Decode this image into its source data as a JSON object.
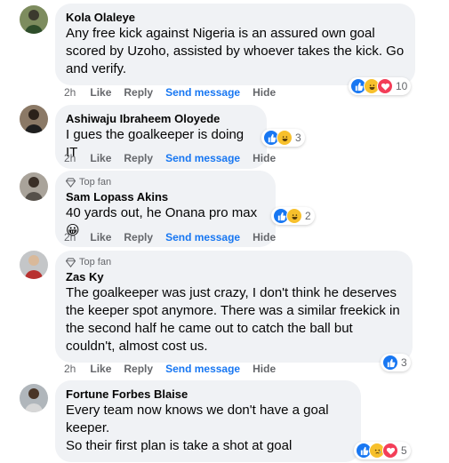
{
  "actions": {
    "like": "Like",
    "reply": "Reply",
    "send": "Send message",
    "hide": "Hide"
  },
  "comments": [
    {
      "author": "Kola Olaleye",
      "top_fan": false,
      "lines": [
        "Any free kick against Nigeria is an assured own goal",
        "scored by Uzoho, assisted by whoever takes the kick. Go",
        "and verify."
      ],
      "time": "2h",
      "reactions": [
        "like",
        "haha",
        "love"
      ],
      "count": "10"
    },
    {
      "author": "Ashiwaju Ibraheem Oloyede",
      "top_fan": false,
      "lines": [
        "I gues the goalkeeper is doing IT"
      ],
      "time": "2h",
      "reactions": [
        "like",
        "haha"
      ],
      "count": "3"
    },
    {
      "author": "Sam Lopass Akins",
      "top_fan": true,
      "lines": [
        "40 yards out, he Onana pro max😀"
      ],
      "time": "2h",
      "reactions": [
        "like",
        "haha"
      ],
      "count": "2"
    },
    {
      "author": "Zas Ky",
      "top_fan": true,
      "lines": [
        "The goalkeeper was just crazy, I don't think he deserves",
        "the keeper spot anymore. There was a similar freekick in",
        "the second half he came out to catch the ball but",
        "couldn't, almost cost us."
      ],
      "time": "2h",
      "reactions": [
        "like"
      ],
      "count": "3"
    },
    {
      "author": "Fortune Forbes Blaise",
      "top_fan": false,
      "lines": [
        "Every team now knows we don't have a goal",
        "keeper.",
        "So their first plan is take a shot at goal"
      ],
      "time": "",
      "reactions": [
        "like",
        "sad",
        "love"
      ],
      "count": "5"
    }
  ],
  "top_fan_label": "Top fan",
  "colors": {
    "like": "#1877f2",
    "love": "#f33e58",
    "haha": "#f7c02c",
    "link": "#65676b"
  }
}
